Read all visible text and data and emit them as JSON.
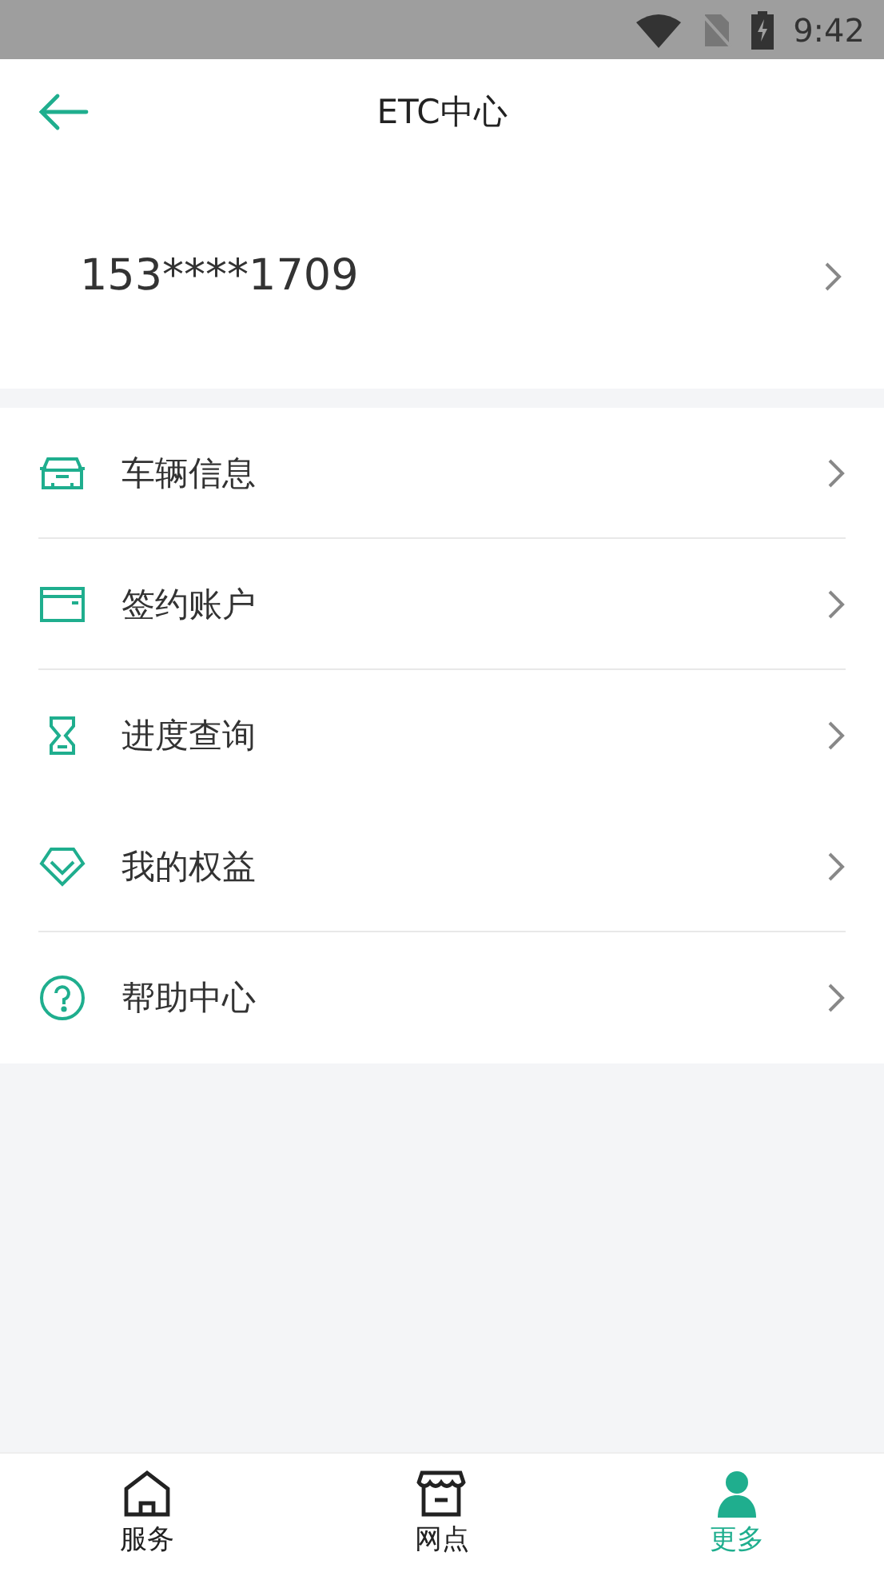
{
  "status_bar": {
    "time": "9:42"
  },
  "header": {
    "title": "ETC中心"
  },
  "account": {
    "phone": "153****1709"
  },
  "menu": [
    {
      "kind": "car",
      "label": "车辆信息",
      "divider_below": true
    },
    {
      "kind": "card",
      "label": "签约账户",
      "divider_below": true
    },
    {
      "kind": "hourglass",
      "label": "进度查询",
      "divider_below": false
    },
    {
      "kind": "diamond",
      "label": "我的权益",
      "divider_below": true
    },
    {
      "kind": "help",
      "label": "帮助中心",
      "divider_below": false
    }
  ],
  "tabs": [
    {
      "kind": "home",
      "label": "服务",
      "selected": false
    },
    {
      "kind": "store",
      "label": "网点",
      "selected": false
    },
    {
      "kind": "person",
      "label": "更多",
      "selected": true
    }
  ]
}
